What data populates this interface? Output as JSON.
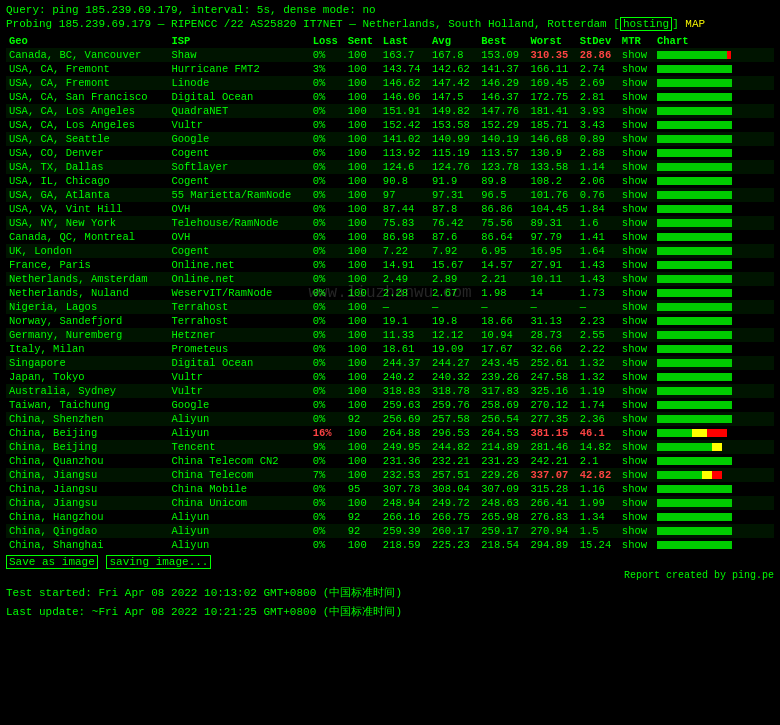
{
  "query": {
    "line": "Query: ping 185.239.69.179, interval: 5s, dense mode: no"
  },
  "probe": {
    "line": "Probing 185.239.69.179 — RIPENCC /22 AS25820 IT7NET — Netherlands, South Holland, Rotterdam",
    "hosting_label": "hosting",
    "map_label": "MAP"
  },
  "table": {
    "headers": [
      "Geo",
      "ISP",
      "Loss",
      "Sent",
      "Last",
      "Avg",
      "Best",
      "Worst",
      "StDev",
      "MTR",
      "Chart"
    ],
    "rows": [
      {
        "geo": "Canada, BC, Vancouver",
        "isp": "Shaw",
        "loss": "0%",
        "sent": "100",
        "last": "163.7",
        "avg": "167.8",
        "best": "153.09",
        "worst": "310.35",
        "stddev": "28.86",
        "mtr": "show",
        "loss_red": false,
        "worst_red": true,
        "stddev_red": true,
        "chart_type": "mostly_green",
        "chart_bars": [
          90,
          5,
          5
        ]
      },
      {
        "geo": "USA, CA, Fremont",
        "isp": "Hurricane FMT2",
        "loss": "3%",
        "sent": "100",
        "last": "143.74",
        "avg": "142.62",
        "best": "141.37",
        "worst": "166.11",
        "stddev": "2.74",
        "mtr": "show",
        "loss_red": false,
        "worst_red": false,
        "stddev_red": false,
        "chart_type": "green_with_bar",
        "chart_bars": [
          95,
          3,
          2
        ]
      },
      {
        "geo": "USA, CA, Fremont",
        "isp": "Linode",
        "loss": "0%",
        "sent": "100",
        "last": "146.62",
        "avg": "147.42",
        "best": "146.29",
        "worst": "169.45",
        "stddev": "2.69",
        "mtr": "show",
        "loss_red": false,
        "worst_red": false,
        "stddev_red": false,
        "chart_type": "green",
        "chart_bars": [
          100,
          0,
          0
        ]
      },
      {
        "geo": "USA, CA, San Francisco",
        "isp": "Digital Ocean",
        "loss": "0%",
        "sent": "100",
        "last": "146.06",
        "avg": "147.5",
        "best": "146.37",
        "worst": "172.75",
        "stddev": "2.81",
        "mtr": "show",
        "loss_red": false,
        "worst_red": false,
        "stddev_red": false,
        "chart_type": "green",
        "chart_bars": [
          100,
          0,
          0
        ]
      },
      {
        "geo": "USA, CA, Los Angeles",
        "isp": "QuadraNET",
        "loss": "0%",
        "sent": "100",
        "last": "151.91",
        "avg": "149.82",
        "best": "147.76",
        "worst": "181.41",
        "stddev": "3.93",
        "mtr": "show",
        "loss_red": false,
        "worst_red": false,
        "stddev_red": false,
        "chart_type": "green",
        "chart_bars": [
          100,
          0,
          0
        ]
      },
      {
        "geo": "USA, CA, Los Angeles",
        "isp": "Vultr",
        "loss": "0%",
        "sent": "100",
        "last": "152.42",
        "avg": "153.58",
        "best": "152.29",
        "worst": "185.71",
        "stddev": "3.43",
        "mtr": "show",
        "loss_red": false,
        "worst_red": false,
        "stddev_red": false,
        "chart_type": "green",
        "chart_bars": [
          100,
          0,
          0
        ]
      },
      {
        "geo": "USA, CA, Seattle",
        "isp": "Google",
        "loss": "0%",
        "sent": "100",
        "last": "141.02",
        "avg": "140.99",
        "best": "140.19",
        "worst": "146.68",
        "stddev": "0.89",
        "mtr": "show",
        "loss_red": false,
        "worst_red": false,
        "stddev_red": false,
        "chart_type": "green",
        "chart_bars": [
          100,
          0,
          0
        ]
      },
      {
        "geo": "USA, CO, Denver",
        "isp": "Cogent",
        "loss": "0%",
        "sent": "100",
        "last": "113.92",
        "avg": "115.19",
        "best": "113.57",
        "worst": "130.9",
        "stddev": "2.88",
        "mtr": "show",
        "loss_red": false,
        "worst_red": false,
        "stddev_red": false,
        "chart_type": "green",
        "chart_bars": [
          100,
          0,
          0
        ]
      },
      {
        "geo": "USA, TX, Dallas",
        "isp": "Softlayer",
        "loss": "0%",
        "sent": "100",
        "last": "124.6",
        "avg": "124.76",
        "best": "123.78",
        "worst": "133.58",
        "stddev": "1.14",
        "mtr": "show",
        "loss_red": false,
        "worst_red": false,
        "stddev_red": false,
        "chart_type": "green",
        "chart_bars": [
          100,
          0,
          0
        ]
      },
      {
        "geo": "USA, IL, Chicago",
        "isp": "Cogent",
        "loss": "0%",
        "sent": "100",
        "last": "90.8",
        "avg": "91.9",
        "best": "89.8",
        "worst": "108.2",
        "stddev": "2.06",
        "mtr": "show",
        "loss_red": false,
        "worst_red": false,
        "stddev_red": false,
        "chart_type": "green",
        "chart_bars": [
          100,
          0,
          0
        ]
      },
      {
        "geo": "USA, GA, Atlanta",
        "isp": "55 Marietta/RamNode",
        "loss": "0%",
        "sent": "100",
        "last": "97",
        "avg": "97.31",
        "best": "96.5",
        "worst": "101.76",
        "stddev": "0.76",
        "mtr": "show",
        "loss_red": false,
        "worst_red": false,
        "stddev_red": false,
        "chart_type": "green",
        "chart_bars": [
          100,
          0,
          0
        ]
      },
      {
        "geo": "USA, VA, Vint Hill",
        "isp": "OVH",
        "loss": "0%",
        "sent": "100",
        "last": "87.44",
        "avg": "87.8",
        "best": "86.86",
        "worst": "104.45",
        "stddev": "1.84",
        "mtr": "show",
        "loss_red": false,
        "worst_red": false,
        "stddev_red": false,
        "chart_type": "green",
        "chart_bars": [
          100,
          0,
          0
        ]
      },
      {
        "geo": "USA, NY, New York",
        "isp": "Telehouse/RamNode",
        "loss": "0%",
        "sent": "100",
        "last": "75.83",
        "avg": "76.42",
        "best": "75.56",
        "worst": "89.31",
        "stddev": "1.6",
        "mtr": "show",
        "loss_red": false,
        "worst_red": false,
        "stddev_red": false,
        "chart_type": "green",
        "chart_bars": [
          100,
          0,
          0
        ]
      },
      {
        "geo": "Canada, QC, Montreal",
        "isp": "OVH",
        "loss": "0%",
        "sent": "100",
        "last": "86.98",
        "avg": "87.6",
        "best": "86.64",
        "worst": "97.79",
        "stddev": "1.41",
        "mtr": "show",
        "loss_red": false,
        "worst_red": false,
        "stddev_red": false,
        "chart_type": "green",
        "chart_bars": [
          100,
          0,
          0
        ]
      },
      {
        "geo": "UK, London",
        "isp": "Cogent",
        "loss": "0%",
        "sent": "100",
        "last": "7.22",
        "avg": "7.92",
        "best": "6.95",
        "worst": "16.95",
        "stddev": "1.64",
        "mtr": "show",
        "loss_red": false,
        "worst_red": false,
        "stddev_red": false,
        "chart_type": "green",
        "chart_bars": [
          100,
          0,
          0
        ]
      },
      {
        "geo": "France, Paris",
        "isp": "Online.net",
        "loss": "0%",
        "sent": "100",
        "last": "14.91",
        "avg": "15.67",
        "best": "14.57",
        "worst": "27.91",
        "stddev": "1.43",
        "mtr": "show",
        "loss_red": false,
        "worst_red": false,
        "stddev_red": false,
        "chart_type": "green",
        "chart_bars": [
          100,
          0,
          0
        ]
      },
      {
        "geo": "Netherlands, Amsterdam",
        "isp": "Online.net",
        "loss": "0%",
        "sent": "100",
        "last": "2.49",
        "avg": "2.89",
        "best": "2.21",
        "worst": "10.11",
        "stddev": "1.43",
        "mtr": "show",
        "loss_red": false,
        "worst_red": false,
        "stddev_red": false,
        "chart_type": "green",
        "chart_bars": [
          100,
          0,
          0
        ]
      },
      {
        "geo": "Netherlands, Nuland",
        "isp": "WeservIT/RamNode",
        "loss": "0%",
        "sent": "100",
        "last": "2.28",
        "avg": "2.67",
        "best": "1.98",
        "worst": "14",
        "stddev": "1.73",
        "mtr": "show",
        "loss_red": false,
        "worst_red": false,
        "stddev_red": false,
        "chart_type": "green",
        "chart_bars": [
          100,
          0,
          0
        ]
      },
      {
        "geo": "Nigeria, Lagos",
        "isp": "Terrahost",
        "loss": "0%",
        "sent": "100",
        "last": "—",
        "avg": "—",
        "best": "—",
        "worst": "—",
        "stddev": "—",
        "mtr": "show",
        "loss_red": false,
        "worst_red": false,
        "stddev_red": false,
        "chart_type": "green",
        "chart_bars": [
          100,
          0,
          0
        ]
      },
      {
        "geo": "Norway, Sandefjord",
        "isp": "Terrahost",
        "loss": "0%",
        "sent": "100",
        "last": "19.1",
        "avg": "19.8",
        "best": "18.66",
        "worst": "31.13",
        "stddev": "2.23",
        "mtr": "show",
        "loss_red": false,
        "worst_red": false,
        "stddev_red": false,
        "chart_type": "green",
        "chart_bars": [
          100,
          0,
          0
        ]
      },
      {
        "geo": "Germany, Nuremberg",
        "isp": "Hetzner",
        "loss": "0%",
        "sent": "100",
        "last": "11.33",
        "avg": "12.12",
        "best": "10.94",
        "worst": "28.73",
        "stddev": "2.55",
        "mtr": "show",
        "loss_red": false,
        "worst_red": false,
        "stddev_red": false,
        "chart_type": "green",
        "chart_bars": [
          100,
          0,
          0
        ]
      },
      {
        "geo": "Italy, Milan",
        "isp": "Prometeus",
        "loss": "0%",
        "sent": "100",
        "last": "18.61",
        "avg": "19.09",
        "best": "17.67",
        "worst": "32.66",
        "stddev": "2.22",
        "mtr": "show",
        "loss_red": false,
        "worst_red": false,
        "stddev_red": false,
        "chart_type": "green",
        "chart_bars": [
          100,
          0,
          0
        ]
      },
      {
        "geo": "Singapore",
        "isp": "Digital Ocean",
        "loss": "0%",
        "sent": "100",
        "last": "244.37",
        "avg": "244.27",
        "best": "243.45",
        "worst": "252.61",
        "stddev": "1.32",
        "mtr": "show",
        "loss_red": false,
        "worst_red": false,
        "stddev_red": false,
        "chart_type": "green",
        "chart_bars": [
          100,
          0,
          0
        ]
      },
      {
        "geo": "Japan, Tokyo",
        "isp": "Vultr",
        "loss": "0%",
        "sent": "100",
        "last": "240.2",
        "avg": "240.32",
        "best": "239.26",
        "worst": "247.58",
        "stddev": "1.32",
        "mtr": "show",
        "loss_red": false,
        "worst_red": false,
        "stddev_red": false,
        "chart_type": "green",
        "chart_bars": [
          100,
          0,
          0
        ]
      },
      {
        "geo": "Australia, Sydney",
        "isp": "Vultr",
        "loss": "0%",
        "sent": "100",
        "last": "318.83",
        "avg": "318.78",
        "best": "317.83",
        "worst": "325.16",
        "stddev": "1.19",
        "mtr": "show",
        "loss_red": false,
        "worst_red": false,
        "stddev_red": false,
        "chart_type": "green",
        "chart_bars": [
          100,
          0,
          0
        ]
      },
      {
        "geo": "Taiwan, Taichung",
        "isp": "Google",
        "loss": "0%",
        "sent": "100",
        "last": "259.63",
        "avg": "259.76",
        "best": "258.69",
        "worst": "270.12",
        "stddev": "1.74",
        "mtr": "show",
        "loss_red": false,
        "worst_red": false,
        "stddev_red": false,
        "chart_type": "green",
        "chart_bars": [
          100,
          0,
          0
        ]
      },
      {
        "geo": "China, Shenzhen",
        "isp": "Aliyun",
        "loss": "0%",
        "sent": "92",
        "last": "256.69",
        "avg": "257.58",
        "best": "256.54",
        "worst": "277.35",
        "stddev": "2.36",
        "mtr": "show",
        "loss_red": false,
        "worst_red": false,
        "stddev_red": false,
        "chart_type": "green",
        "chart_bars": [
          100,
          0,
          0
        ]
      },
      {
        "geo": "China, Beijing",
        "isp": "Aliyun",
        "loss": "16%",
        "sent": "100",
        "last": "264.88",
        "avg": "296.53",
        "best": "264.53",
        "worst": "381.15",
        "stddev": "46.1",
        "mtr": "show",
        "loss_red": true,
        "worst_red": true,
        "stddev_red": true,
        "chart_type": "mixed_red",
        "chart_bars": [
          50,
          25,
          25
        ]
      },
      {
        "geo": "China, Beijing",
        "isp": "Tencent",
        "loss": "9%",
        "sent": "100",
        "last": "249.95",
        "avg": "244.82",
        "best": "214.89",
        "worst": "281.46",
        "stddev": "14.82",
        "mtr": "show",
        "loss_red": false,
        "worst_red": false,
        "stddev_red": false,
        "chart_type": "green_mixed",
        "chart_bars": [
          70,
          20,
          10
        ]
      },
      {
        "geo": "China, Quanzhou",
        "isp": "China Telecom CN2",
        "loss": "0%",
        "sent": "100",
        "last": "231.36",
        "avg": "232.21",
        "best": "231.23",
        "worst": "242.21",
        "stddev": "2.1",
        "mtr": "show",
        "loss_red": false,
        "worst_red": false,
        "stddev_red": false,
        "chart_type": "green",
        "chart_bars": [
          100,
          0,
          0
        ]
      },
      {
        "geo": "China, Jiangsu",
        "isp": "China Telecom",
        "loss": "7%",
        "sent": "100",
        "last": "232.53",
        "avg": "257.51",
        "best": "229.26",
        "worst": "337.07",
        "stddev": "42.82",
        "mtr": "show",
        "loss_red": false,
        "worst_red": true,
        "stddev_red": true,
        "chart_type": "mixed_yellow_red",
        "chart_bars": [
          60,
          20,
          20
        ]
      },
      {
        "geo": "China, Jiangsu",
        "isp": "China Mobile",
        "loss": "0%",
        "sent": "95",
        "last": "307.78",
        "avg": "308.04",
        "best": "307.09",
        "worst": "315.28",
        "stddev": "1.16",
        "mtr": "show",
        "loss_red": false,
        "worst_red": false,
        "stddev_red": false,
        "chart_type": "green",
        "chart_bars": [
          100,
          0,
          0
        ]
      },
      {
        "geo": "China, Jiangsu",
        "isp": "China Unicom",
        "loss": "0%",
        "sent": "100",
        "last": "248.94",
        "avg": "249.72",
        "best": "248.63",
        "worst": "266.41",
        "stddev": "1.99",
        "mtr": "show",
        "loss_red": false,
        "worst_red": false,
        "stddev_red": false,
        "chart_type": "green",
        "chart_bars": [
          100,
          0,
          0
        ]
      },
      {
        "geo": "China, Hangzhou",
        "isp": "Aliyun",
        "loss": "0%",
        "sent": "92",
        "last": "266.16",
        "avg": "266.75",
        "best": "265.98",
        "worst": "276.83",
        "stddev": "1.34",
        "mtr": "show",
        "loss_red": false,
        "worst_red": false,
        "stddev_red": false,
        "chart_type": "green",
        "chart_bars": [
          100,
          0,
          0
        ]
      },
      {
        "geo": "China, Qingdao",
        "isp": "Aliyun",
        "loss": "0%",
        "sent": "92",
        "last": "259.39",
        "avg": "260.17",
        "best": "259.17",
        "worst": "270.94",
        "stddev": "1.5",
        "mtr": "show",
        "loss_red": false,
        "worst_red": false,
        "stddev_red": false,
        "chart_type": "green",
        "chart_bars": [
          100,
          0,
          0
        ]
      },
      {
        "geo": "China, Shanghai",
        "isp": "Aliyun",
        "loss": "0%",
        "sent": "100",
        "last": "218.59",
        "avg": "225.23",
        "best": "218.54",
        "worst": "294.89",
        "stddev": "15.24",
        "mtr": "show",
        "loss_red": false,
        "worst_red": false,
        "stddev_red": false,
        "chart_type": "green",
        "chart_bars": [
          100,
          0,
          0
        ]
      }
    ]
  },
  "footer": {
    "save_image_label": "Save as image",
    "saving_label": "saving image...",
    "report_credit": "Report created by ping.pe",
    "test_started": "Test started: Fri Apr 08 2022 10:13:02 GMT+0800 (中国标准时间)",
    "last_update": "Last update: ~Fri Apr 08 2022 10:21:25 GMT+0800 (中国标准时间)"
  },
  "watermark": "www.liuzhanwu.com"
}
